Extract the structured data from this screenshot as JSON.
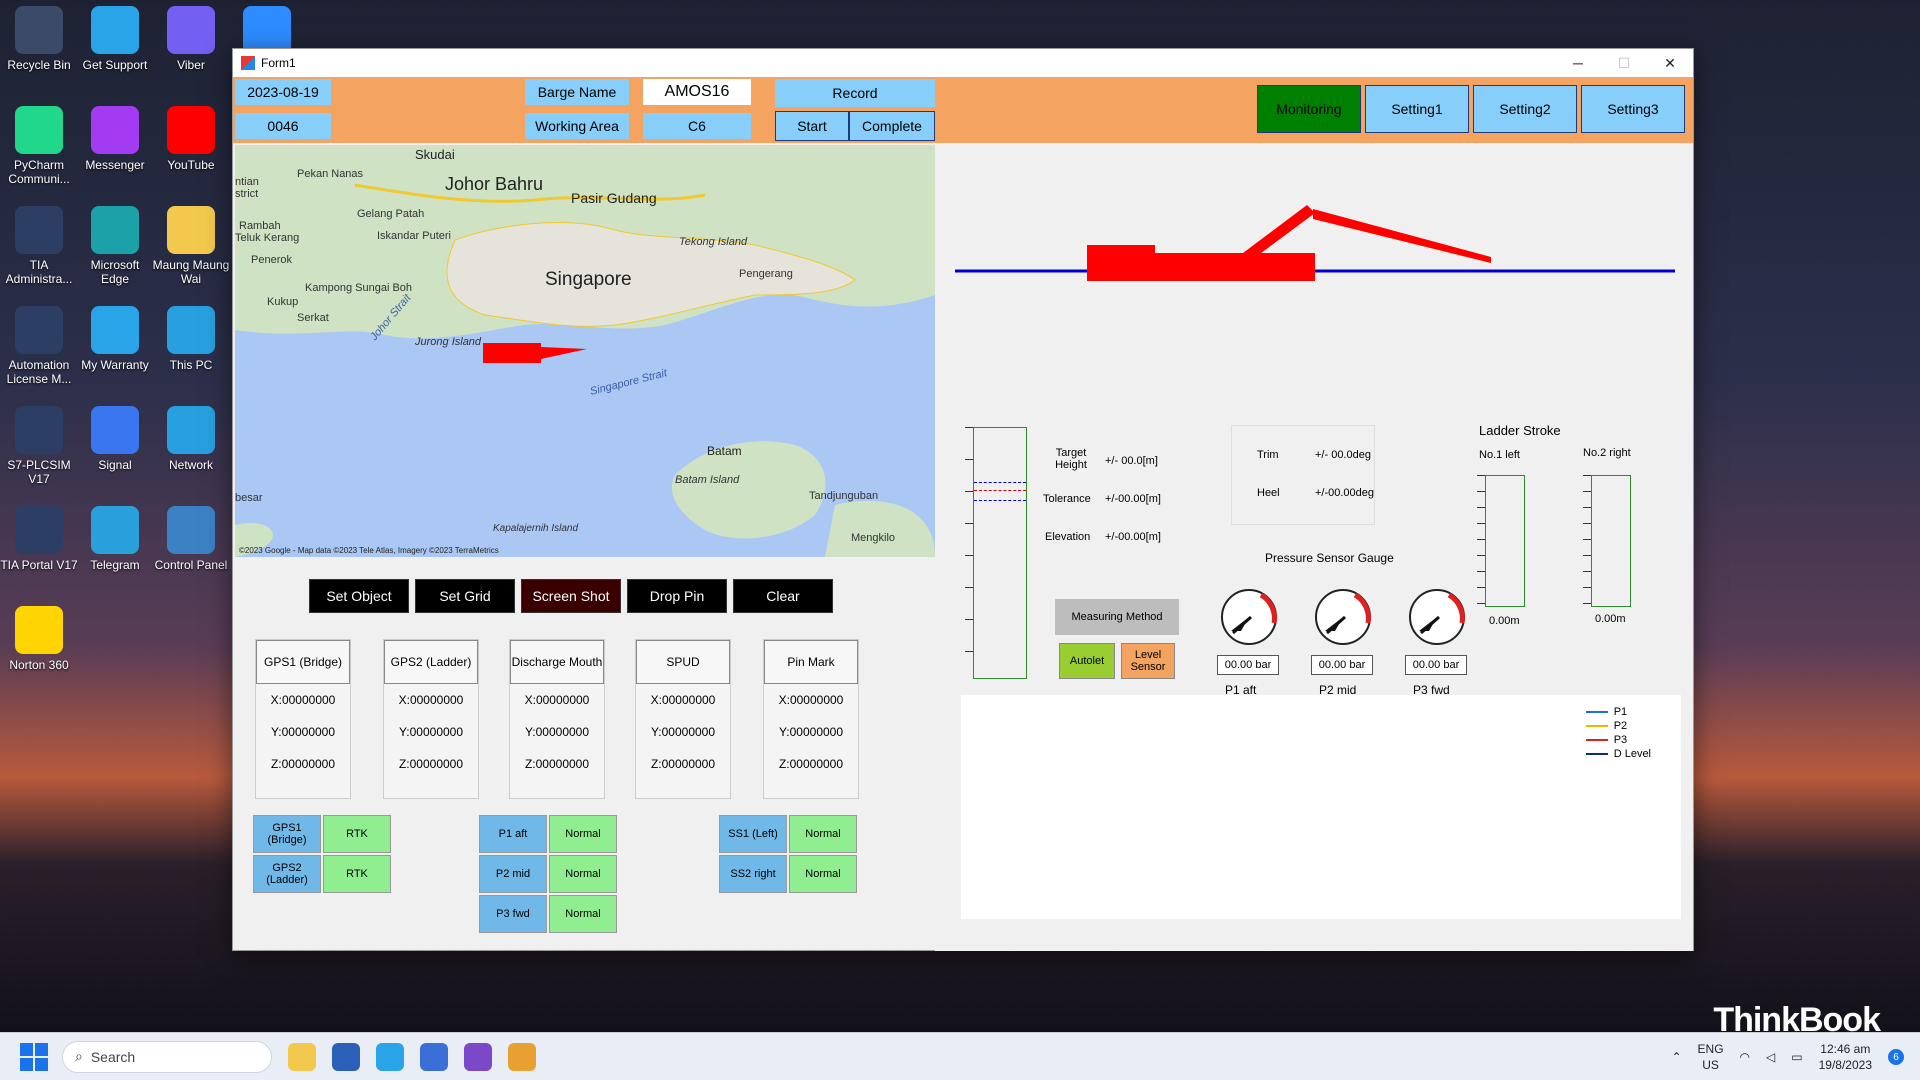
{
  "desktop": {
    "icons": [
      {
        "label": "Recycle Bin",
        "icon": "recycle-bin-icon",
        "color": "#3a4a68"
      },
      {
        "label": "Get Support",
        "icon": "lenovo-support-icon",
        "color": "#2aa4e8"
      },
      {
        "label": "Viber",
        "icon": "viber-icon",
        "color": "#7360f2"
      },
      {
        "label": "zoom",
        "icon": "zoom-icon",
        "color": "#2d8cff"
      },
      {
        "label": "PyCharm Communi...",
        "icon": "pycharm-icon",
        "color": "#21d789"
      },
      {
        "label": "Messenger",
        "icon": "messenger-icon",
        "color": "#a33bf2"
      },
      {
        "label": "YouTube",
        "icon": "youtube-icon",
        "color": "#ff0000"
      },
      {
        "label": "TIA Administra...",
        "icon": "tia-admin-icon",
        "color": "#2c3e63"
      },
      {
        "label": "Microsoft Edge",
        "icon": "edge-icon",
        "color": "#1aa2a8"
      },
      {
        "label": "Maung Maung Wai",
        "icon": "folder-icon",
        "color": "#f2c94c"
      },
      {
        "label": "Automation License M...",
        "icon": "license-manager-icon",
        "color": "#2c3e63"
      },
      {
        "label": "My Warranty",
        "icon": "warranty-icon",
        "color": "#2aa4e8"
      },
      {
        "label": "This PC",
        "icon": "pc-icon",
        "color": "#28a0e0"
      },
      {
        "label": "S7-PLCSIM V17",
        "icon": "plcsim-icon",
        "color": "#2c3e63"
      },
      {
        "label": "Signal",
        "icon": "signal-icon",
        "color": "#3a76f0"
      },
      {
        "label": "Network",
        "icon": "network-icon",
        "color": "#28a0e0"
      },
      {
        "label": "TIA Portal V17",
        "icon": "tia-portal-icon",
        "color": "#2c3e63"
      },
      {
        "label": "Telegram",
        "icon": "telegram-icon",
        "color": "#2aa0da"
      },
      {
        "label": "Control Panel",
        "icon": "control-panel-icon",
        "color": "#3b82c4"
      },
      {
        "label": "Norton 360",
        "icon": "norton-icon",
        "color": "#ffd400"
      }
    ],
    "brand": "ThinkBook"
  },
  "taskbar": {
    "search_placeholder": "Search",
    "lang": "ENG",
    "region": "US",
    "time": "12:46 am",
    "date": "19/8/2023",
    "notif": "6"
  },
  "window": {
    "title": "Form1",
    "minimize": "─",
    "maximize": "☐",
    "close": "✕"
  },
  "header": {
    "date": "2023-08-19",
    "id": "0046",
    "barge_name_label": "Barge Name",
    "barge_name_value": "AMOS16",
    "working_area_label": "Working Area",
    "working_area_value": "C6",
    "record_label": "Record",
    "start_label": "Start",
    "complete_label": "Complete",
    "tabs": [
      "Monitoring",
      "Setting1",
      "Setting2",
      "Setting3"
    ],
    "active_tab_color": "#008000"
  },
  "map": {
    "places": [
      "Skudai",
      "Pekan Nanas",
      "Johor Bahru",
      "Pasir Gudang",
      "ntian",
      "strict",
      "Gelang Patah",
      "Rambah",
      "Teluk Kerang",
      "Iskandar Puteri",
      "Tekong Island",
      "Penerok",
      "Singapore",
      "Pengerang",
      "Kampong Sungai Boh",
      "Kukup",
      "Serkat",
      "Johor Strait",
      "Jurong Island",
      "Singapore Strait",
      "Batam",
      "Batam Island",
      "besar",
      "Tandjunguban",
      "Kapalajernih Island",
      "Mengkilo"
    ],
    "attribution": "©2023 Google - Map data ©2023 Tele Atlas, Imagery ©2023 TerraMetrics"
  },
  "actions": [
    "Set Object",
    "Set Grid",
    "Screen Shot",
    "Drop Pin",
    "Clear"
  ],
  "gps_boxes": [
    {
      "title": "GPS1 (Bridge)",
      "x": "X:00000000",
      "y": "Y:00000000",
      "z": "Z:00000000"
    },
    {
      "title": "GPS2 (Ladder)",
      "x": "X:00000000",
      "y": "Y:00000000",
      "z": "Z:00000000"
    },
    {
      "title": "Discharge Mouth",
      "x": "X:00000000",
      "y": "Y:00000000",
      "z": "Z:00000000"
    },
    {
      "title": "SPUD",
      "x": "X:00000000",
      "y": "Y:00000000",
      "z": "Z:00000000"
    },
    {
      "title": "Pin Mark",
      "x": "X:00000000",
      "y": "Y:00000000",
      "z": "Z:00000000"
    }
  ],
  "status": {
    "gps": [
      {
        "name": "GPS1 (Bridge)",
        "value": "RTK"
      },
      {
        "name": "GPS2 (Ladder)",
        "value": "RTK"
      }
    ],
    "pressure": [
      {
        "name": "P1 aft",
        "value": "Normal"
      },
      {
        "name": "P2 mid",
        "value": "Normal"
      },
      {
        "name": "P3 fwd",
        "value": "Normal"
      }
    ],
    "spud": [
      {
        "name": "SS1 (Left)",
        "value": "Normal"
      },
      {
        "name": "SS2 right",
        "value": "Normal"
      }
    ]
  },
  "measure": {
    "target_height_label": "Target Height",
    "target_height_value": "+/- 00.0[m]",
    "tolerance_label": "Tolerance",
    "tolerance_value": "+/-00.00[m]",
    "elevation_label": "Elevation",
    "elevation_value": "+/-00.00[m]",
    "method_label": "Measuring Method",
    "autolet_label": "Autolet",
    "level_sensor_label": "Level Sensor",
    "trim_label": "Trim",
    "trim_value": "+/- 00.0deg",
    "heel_label": "Heel",
    "heel_value": "+/-00.00deg"
  },
  "pressure_gauges": {
    "title": "Pressure Sensor Gauge",
    "gauges": [
      {
        "label": "P1 aft",
        "value": "00.00 bar"
      },
      {
        "label": "P2 mid",
        "value": "00.00 bar"
      },
      {
        "label": "P3 fwd",
        "value": "00.00 bar"
      }
    ]
  },
  "ladder": {
    "title": "Ladder Stroke",
    "left_label": "No.1 left",
    "right_label": "No.2 right",
    "left_value": "0.00m",
    "right_value": "0.00m"
  },
  "legend": [
    {
      "name": "P1",
      "color": "#1e6fd9"
    },
    {
      "name": "P2",
      "color": "#f0b400"
    },
    {
      "name": "P3",
      "color": "#e02020"
    },
    {
      "name": "D Level",
      "color": "#0a2a8a"
    }
  ]
}
